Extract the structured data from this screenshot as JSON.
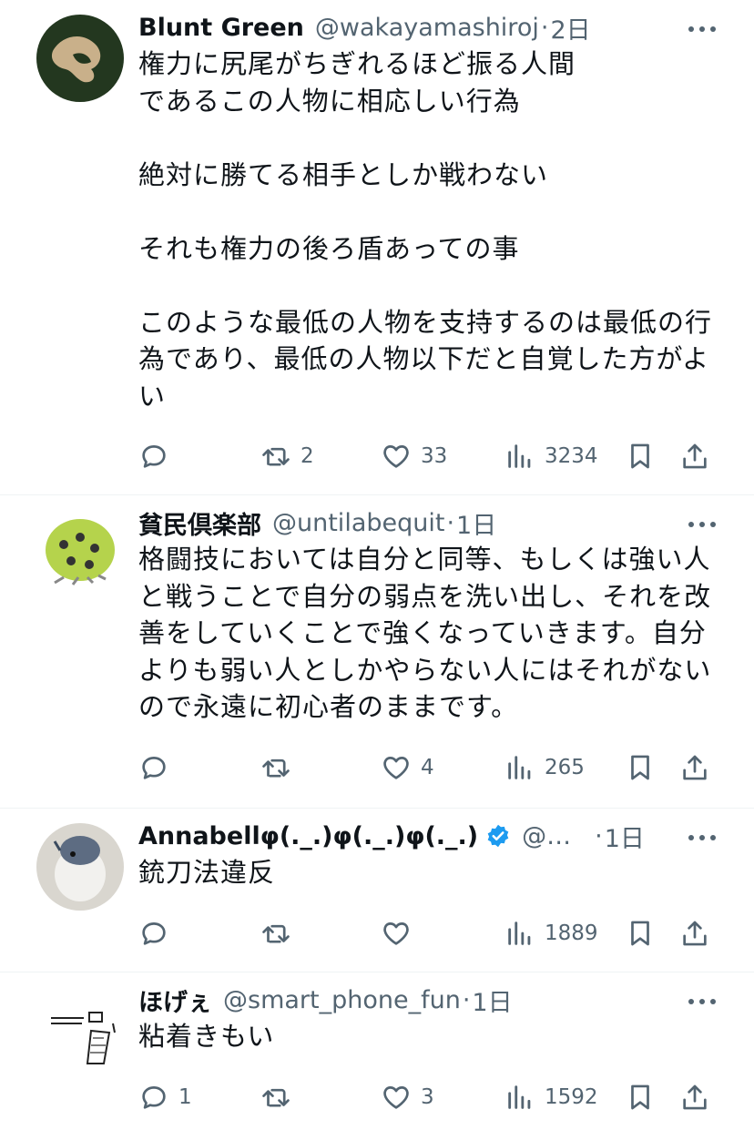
{
  "tweets": [
    {
      "name": "Blunt Green",
      "handle": "@wakayamashiroj",
      "dot": "·",
      "time": "2日",
      "verified": false,
      "text": "権力に尻尾がちぎれるほど振る人間\nであるこの人物に相応しい行為\n\n絶対に勝てる相手としか戦わない\n\nそれも権力の後ろ盾あっての事\n\nこのような最低の人物を支持するのは最低の行\n為であり、最低の人物以下だと自覚した方がよ\nい",
      "reply_count": "",
      "retweet_count": "2",
      "like_count": "33",
      "view_count": "3234"
    },
    {
      "name": "貧民倶楽部",
      "handle": "@untilabequit",
      "dot": "·",
      "time": "1日",
      "verified": false,
      "text": "格闘技においては自分と同等、もしくは強い人\nと戦うことで自分の弱点を洗い出し、それを改\n善をしていくことで強くなっていきます。自分\nよりも弱い人としかやらない人にはそれがない\nので永遠に初心者のままです。",
      "reply_count": "",
      "retweet_count": "",
      "like_count": "4",
      "view_count": "265"
    },
    {
      "name": "Annabellφ(._.)φ(._.)φ(._.)",
      "handle": "@m...",
      "dot": "·",
      "time": "1日",
      "verified": true,
      "text": "銃刀法違反",
      "reply_count": "",
      "retweet_count": "",
      "like_count": "",
      "view_count": "1889"
    },
    {
      "name": "ほげぇ",
      "handle": "@smart_phone_fun",
      "dot": "·",
      "time": "1日",
      "verified": false,
      "text": "粘着きもい",
      "reply_count": "1",
      "retweet_count": "",
      "like_count": "3",
      "view_count": "1592"
    }
  ],
  "colors": {
    "text": "#0f1419",
    "secondary": "#536471",
    "verified": "#1d9bf0",
    "divider": "#eff3f4"
  },
  "icons": [
    "reply-icon",
    "retweet-icon",
    "like-icon",
    "views-icon",
    "bookmark-icon",
    "share-icon",
    "more-icon",
    "verified-badge-icon"
  ]
}
